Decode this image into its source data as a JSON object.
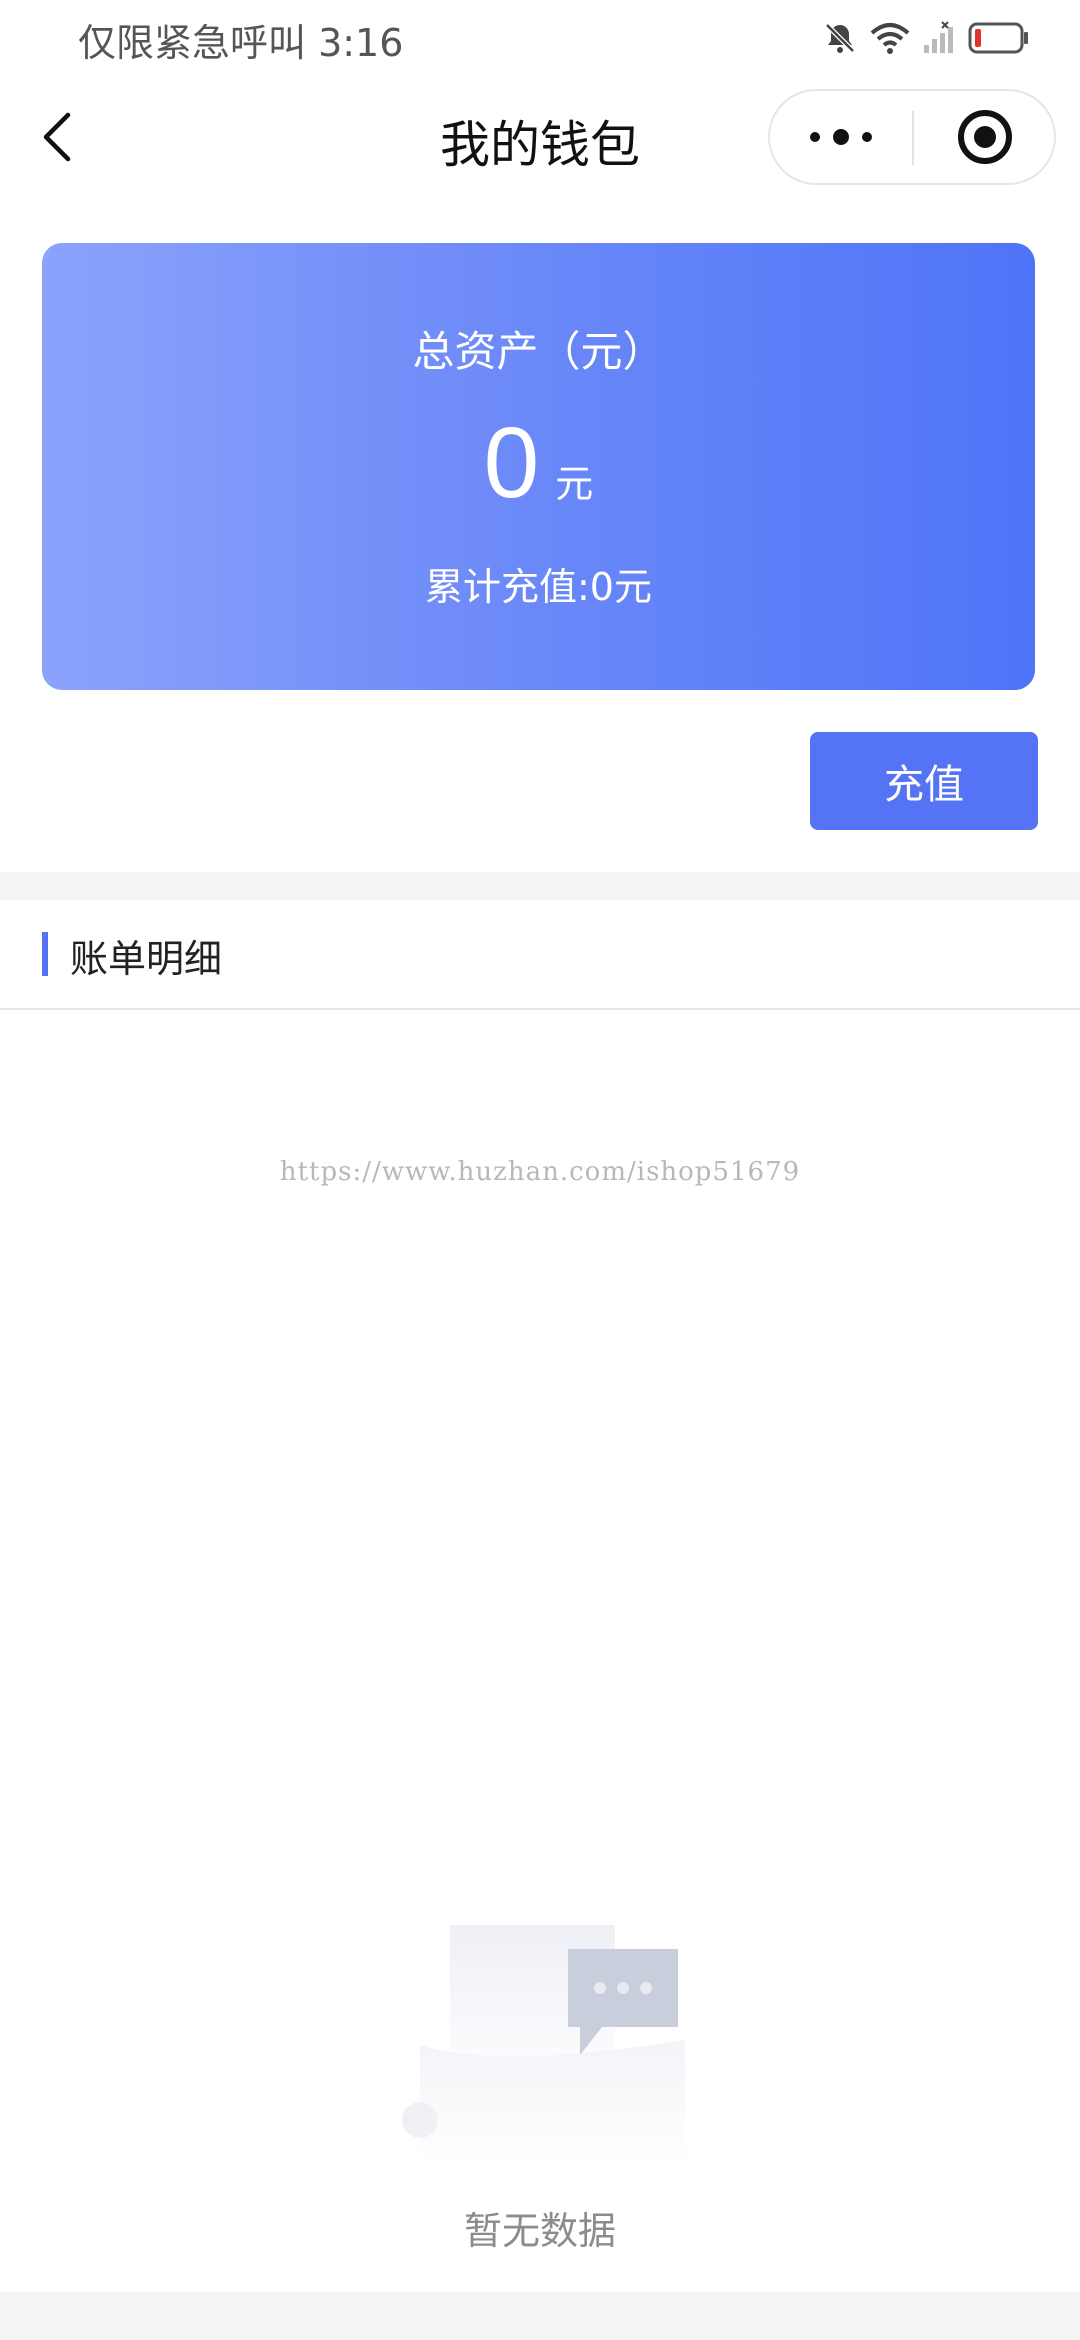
{
  "status_bar": {
    "carrier_time": "仅限紧急呼叫 3:16",
    "icons": [
      "bell-muted-icon",
      "wifi-icon",
      "signal-icon",
      "battery-low-icon"
    ]
  },
  "nav": {
    "title": "我的钱包",
    "back_icon": "chevron-left-icon",
    "more_icon": "more-dots-icon",
    "close_icon": "target-icon"
  },
  "wallet": {
    "label": "总资产（元）",
    "amount": "0",
    "unit": "元",
    "total_recharged": "累计充值:0元"
  },
  "actions": {
    "recharge_label": "充值"
  },
  "bill": {
    "title": "账单明细",
    "empty_text": "暂无数据"
  },
  "watermark": "https://www.huzhan.com/ishop51679",
  "colors": {
    "accent": "#5474f5",
    "card_gradient_start": "#8ba3fb",
    "card_gradient_end": "#4e74f7"
  }
}
